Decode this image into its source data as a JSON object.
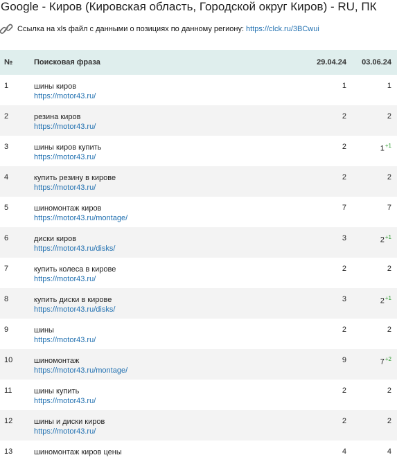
{
  "header": {
    "title": "Google - Киров (Кировская область, Городской округ Киров) - RU, ПК",
    "link_text": "Ссылка на xls файл с данными о позициях по данному региону:",
    "link_url": "https://clck.ru/3BCwui"
  },
  "table": {
    "columns": [
      "№",
      "Поисковая фраза",
      "29.04.24",
      "03.06.24"
    ],
    "rows": [
      {
        "num": "1",
        "phrase": "шины киров",
        "url": "https://motor43.ru/",
        "d1": "1",
        "d2": "1",
        "delta": ""
      },
      {
        "num": "2",
        "phrase": "резина киров",
        "url": "https://motor43.ru/",
        "d1": "2",
        "d2": "2",
        "delta": ""
      },
      {
        "num": "3",
        "phrase": "шины киров купить",
        "url": "https://motor43.ru/",
        "d1": "2",
        "d2": "1",
        "delta": "+1"
      },
      {
        "num": "4",
        "phrase": "купить резину в кирове",
        "url": "https://motor43.ru/",
        "d1": "2",
        "d2": "2",
        "delta": ""
      },
      {
        "num": "5",
        "phrase": "шиномонтаж киров",
        "url": "https://motor43.ru/montage/",
        "d1": "7",
        "d2": "7",
        "delta": ""
      },
      {
        "num": "6",
        "phrase": "диски киров",
        "url": "https://motor43.ru/disks/",
        "d1": "3",
        "d2": "2",
        "delta": "+1"
      },
      {
        "num": "7",
        "phrase": "купить колеса в кирове",
        "url": "https://motor43.ru/",
        "d1": "2",
        "d2": "2",
        "delta": ""
      },
      {
        "num": "8",
        "phrase": "купить диски в кирове",
        "url": "https://motor43.ru/disks/",
        "d1": "3",
        "d2": "2",
        "delta": "+1"
      },
      {
        "num": "9",
        "phrase": "шины",
        "url": "https://motor43.ru/",
        "d1": "2",
        "d2": "2",
        "delta": ""
      },
      {
        "num": "10",
        "phrase": "шиномонтаж",
        "url": "https://motor43.ru/montage/",
        "d1": "9",
        "d2": "7",
        "delta": "+2"
      },
      {
        "num": "11",
        "phrase": "шины купить",
        "url": "https://motor43.ru/",
        "d1": "2",
        "d2": "2",
        "delta": ""
      },
      {
        "num": "12",
        "phrase": "шины и диски киров",
        "url": "https://motor43.ru/",
        "d1": "2",
        "d2": "2",
        "delta": ""
      },
      {
        "num": "13",
        "phrase": "шиномонтаж киров цены",
        "url": "",
        "d1": "4",
        "d2": "4",
        "delta": ""
      }
    ]
  },
  "colors": {
    "header_bg": "#dfeeed",
    "link": "#1f6fb0",
    "delta_positive": "#2a9a2a",
    "row_alt": "#f3f3f3"
  },
  "icons": {
    "link_icon": "chain-link-icon"
  }
}
